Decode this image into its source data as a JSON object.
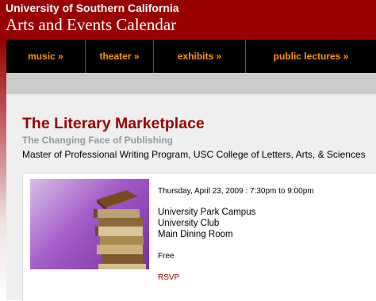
{
  "header": {
    "university": "University of Southern California",
    "title": "Arts and Events Calendar"
  },
  "nav": {
    "items": [
      {
        "label": "music »"
      },
      {
        "label": "theater »"
      },
      {
        "label": "exhibits »"
      },
      {
        "label": "public lectures »"
      }
    ]
  },
  "event": {
    "title": "The Literary Marketplace",
    "subtitle": "The Changing Face of Publishing",
    "program": "Master of Professional Writing Program, USC College of Letters, Arts, & Sciences",
    "datetime": "Thursday, April 23, 2009 : 7:30pm to 9:00pm",
    "location": [
      "University Park Campus",
      "University Club",
      "Main Dining Room"
    ],
    "price": "Free",
    "rsvp_label": "RSVP"
  },
  "colors": {
    "brand": "#990000",
    "nav_text": "#ff9900",
    "nav_bg": "#000000"
  }
}
